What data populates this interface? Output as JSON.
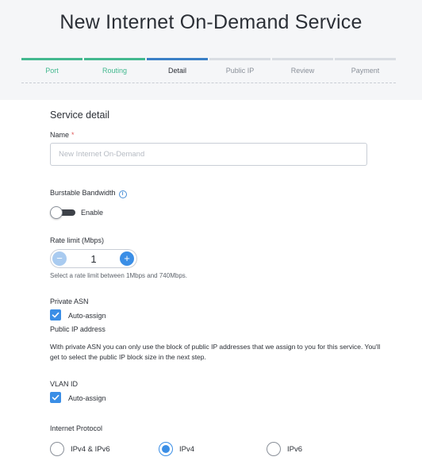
{
  "page": {
    "title": "New Internet On-Demand Service"
  },
  "steps": [
    {
      "label": "Port",
      "state": "done"
    },
    {
      "label": "Routing",
      "state": "done"
    },
    {
      "label": "Detail",
      "state": "active"
    },
    {
      "label": "Public IP",
      "state": "pending"
    },
    {
      "label": "Review",
      "state": "pending"
    },
    {
      "label": "Payment",
      "state": "pending"
    }
  ],
  "form": {
    "section_title": "Service detail",
    "name": {
      "label": "Name",
      "required_mark": "*",
      "value": "",
      "placeholder": "New Internet On-Demand"
    },
    "burstable": {
      "label": "Burstable Bandwidth",
      "info_icon": "i",
      "toggle_label": "Enable",
      "enabled": false
    },
    "rate_limit": {
      "label": "Rate limit (Mbps)",
      "value": "1",
      "minus": "−",
      "plus": "+",
      "help": "Select a rate limit between 1Mbps and 740Mbps."
    },
    "private_asn": {
      "label": "Private ASN",
      "checkbox_label": "Auto-assign",
      "checked": true
    },
    "public_ip": {
      "label": "Public IP address",
      "description": "With private ASN you can only use the block of public IP addresses that we assign to you for this service. You'll get to select the public IP block size in the next step."
    },
    "vlan": {
      "label": "VLAN ID",
      "checkbox_label": "Auto-assign",
      "checked": true
    },
    "protocol": {
      "label": "Internet Protocol",
      "options": [
        "IPv4 & IPv6",
        "IPv4",
        "IPv6"
      ],
      "selected": "IPv4"
    }
  },
  "colors": {
    "done": "#43b88f",
    "active": "#3a7fc6",
    "accent": "#3a8ee6"
  }
}
